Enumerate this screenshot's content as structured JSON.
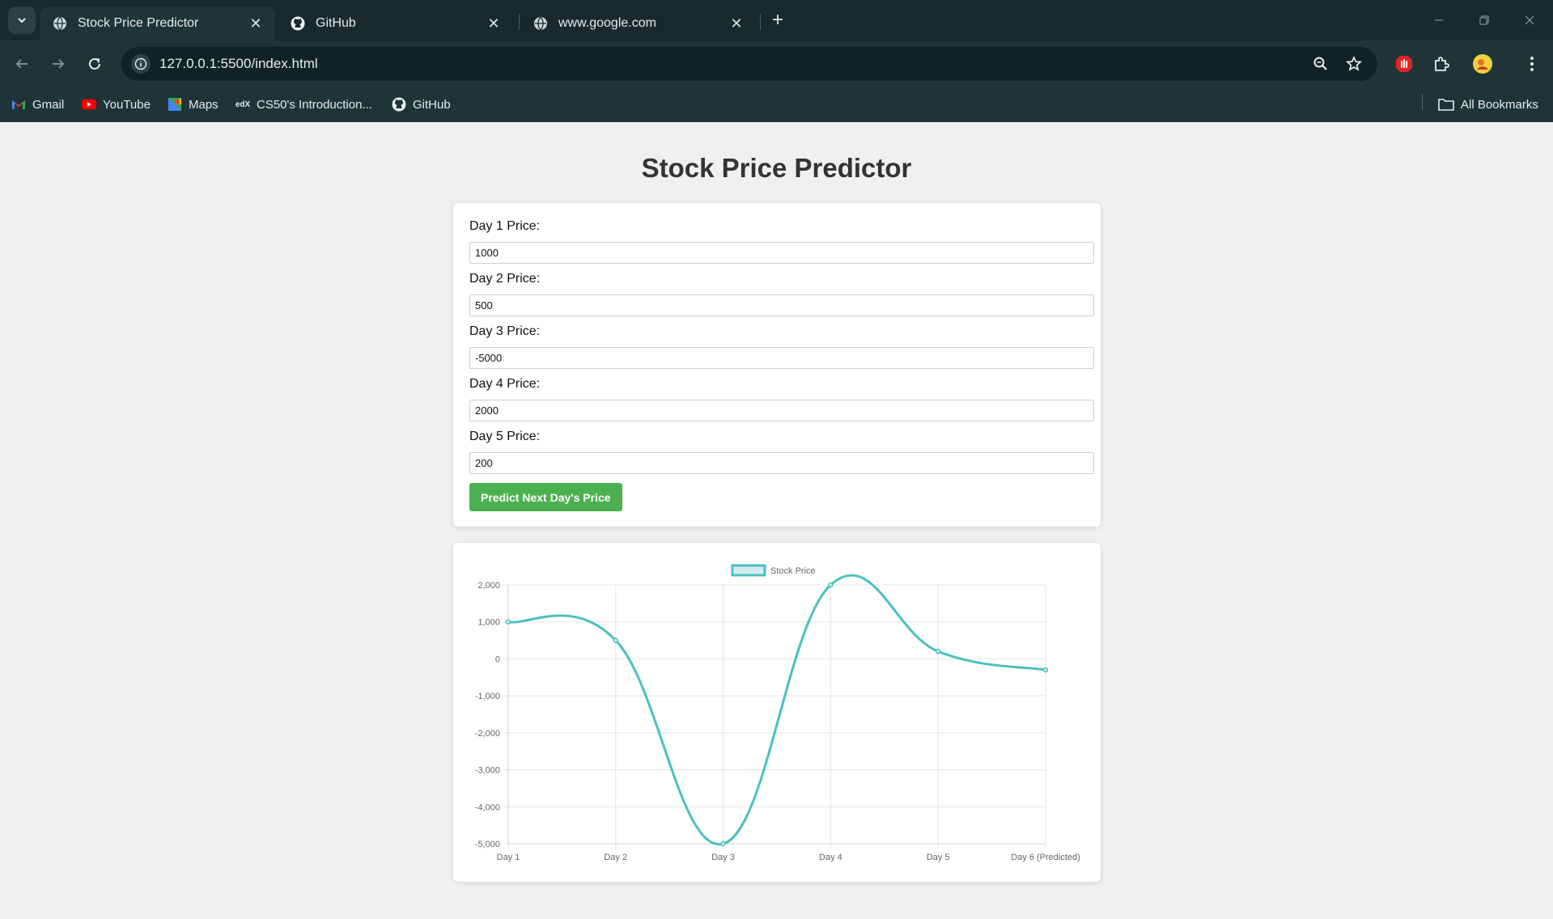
{
  "browser": {
    "tabs": [
      {
        "title": "Stock Price Predictor",
        "icon": "globe-icon",
        "active": true
      },
      {
        "title": "GitHub",
        "icon": "github-icon",
        "active": false
      },
      {
        "title": "www.google.com",
        "icon": "globe-icon",
        "active": false
      }
    ],
    "url": "127.0.0.1:5500/index.html",
    "bookmarks": [
      {
        "label": "Gmail",
        "icon": "gmail-icon"
      },
      {
        "label": "YouTube",
        "icon": "youtube-icon"
      },
      {
        "label": "Maps",
        "icon": "maps-icon"
      },
      {
        "label": "CS50's Introduction...",
        "icon": "edx-icon"
      },
      {
        "label": "GitHub",
        "icon": "github-icon"
      }
    ],
    "all_bookmarks_label": "All Bookmarks"
  },
  "page": {
    "title": "Stock Price Predictor",
    "fields": [
      {
        "label": "Day 1 Price:",
        "value": "1000"
      },
      {
        "label": "Day 2 Price:",
        "value": "500"
      },
      {
        "label": "Day 3 Price:",
        "value": "-5000"
      },
      {
        "label": "Day 4 Price:",
        "value": "2000"
      },
      {
        "label": "Day 5 Price:",
        "value": "200"
      }
    ],
    "predict_button": "Predict Next Day's Price"
  },
  "chart_data": {
    "type": "line",
    "categories": [
      "Day 1",
      "Day 2",
      "Day 3",
      "Day 4",
      "Day 5",
      "Day 6 (Predicted)"
    ],
    "series": [
      {
        "name": "Stock Price",
        "values": [
          1000,
          500,
          -5000,
          2000,
          200,
          -300
        ],
        "color": "#4bc0c0"
      }
    ],
    "yticks": [
      "2,000",
      "1,000",
      "0",
      "-1,000",
      "-2,000",
      "-3,000",
      "-4,000",
      "-5,000"
    ],
    "ylim": [
      -5000,
      2000
    ],
    "grid": true,
    "legend": "top-center",
    "title": "",
    "xlabel": "",
    "ylabel": ""
  },
  "colors": {
    "accent": "#4caf50",
    "line": "#4bc0c0",
    "chrome": "#1f3438"
  }
}
